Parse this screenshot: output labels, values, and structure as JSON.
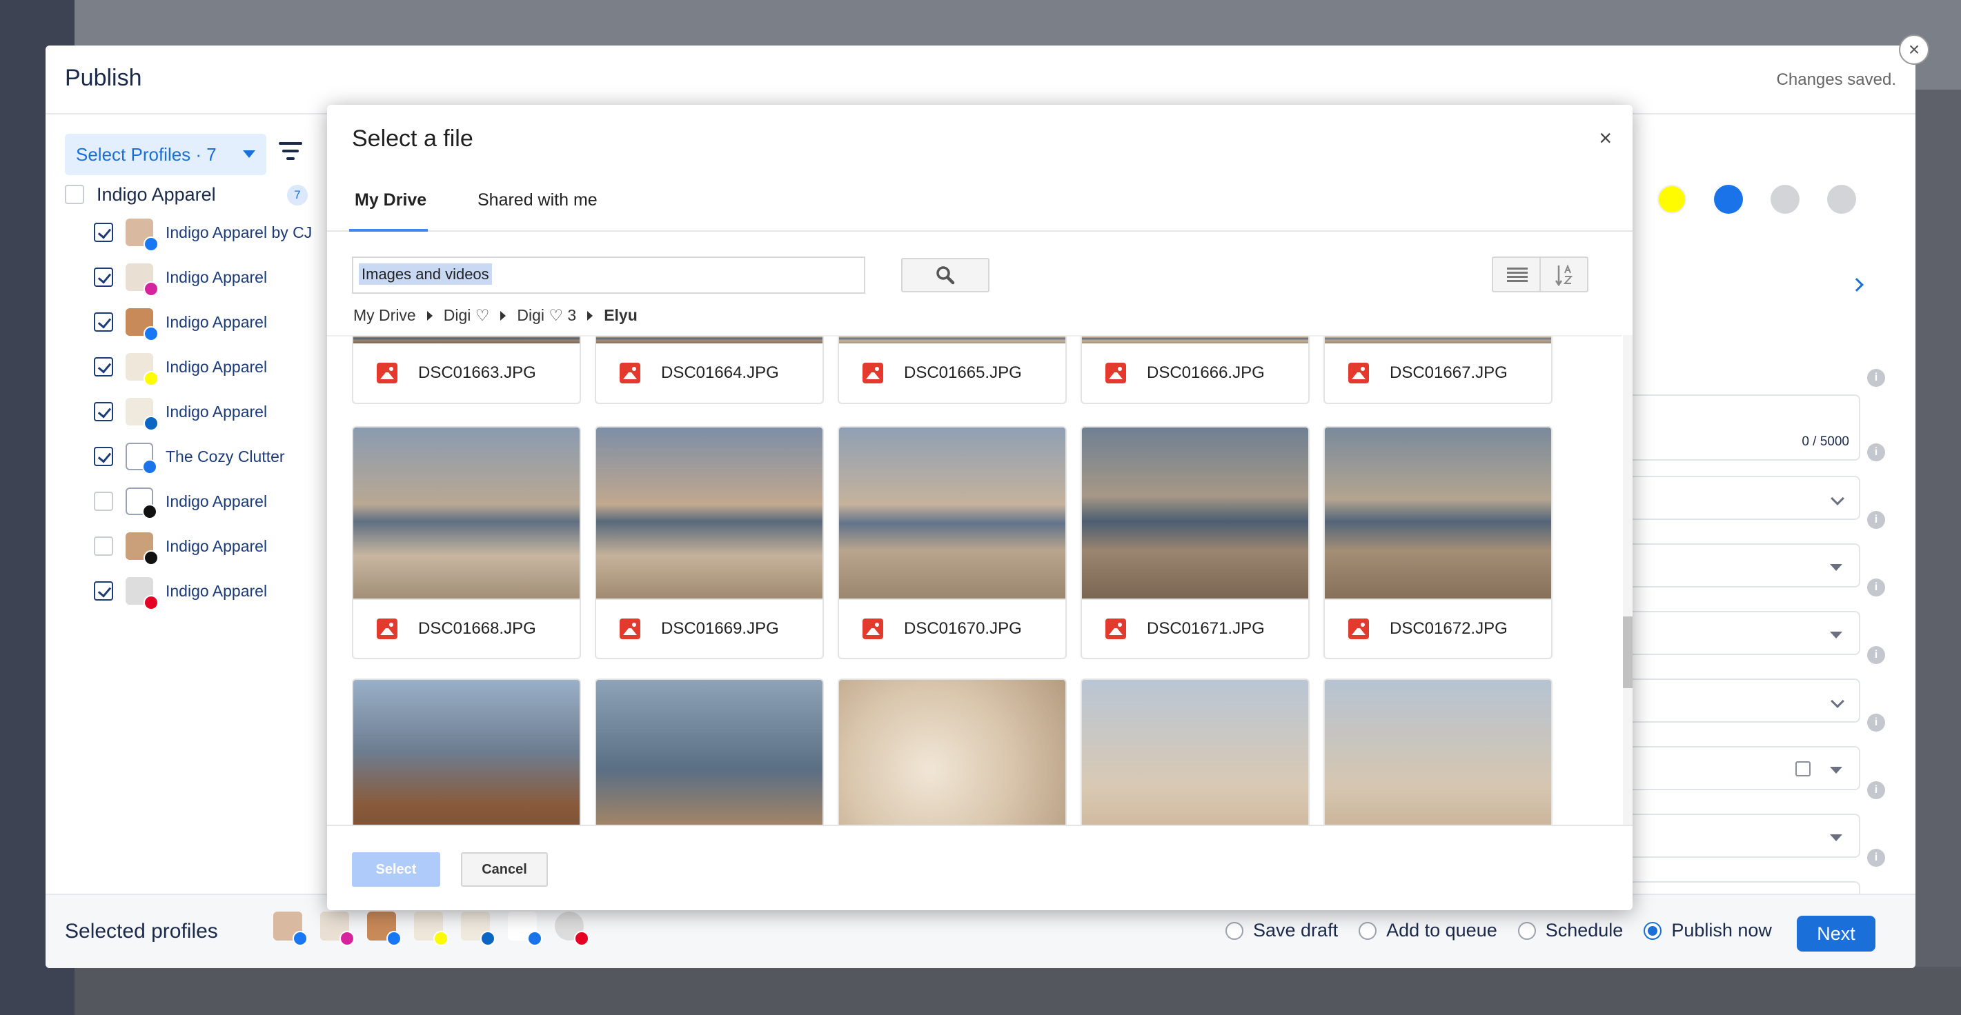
{
  "publish": {
    "title": "Publish",
    "status": "Changes saved.",
    "profiles_select": "Select Profiles · 7",
    "group": {
      "label": "Indigo Apparel",
      "count": "7"
    },
    "profiles": [
      {
        "label": "Indigo Apparel by CJ",
        "checked": true,
        "network": "facebook",
        "badge_color": "#1877f2"
      },
      {
        "label": "Indigo Apparel",
        "checked": true,
        "network": "instagram",
        "badge_color": "#d6249f"
      },
      {
        "label": "Indigo Apparel",
        "checked": true,
        "network": "facebook",
        "badge_color": "#1877f2"
      },
      {
        "label": "Indigo Apparel",
        "checked": true,
        "network": "snapchat",
        "badge_color": "#fffc00"
      },
      {
        "label": "Indigo Apparel",
        "checked": true,
        "network": "linkedin",
        "badge_color": "#0a66c2"
      },
      {
        "label": "The Cozy Clutter",
        "checked": true,
        "network": "google-business",
        "badge_color": "#1a73e8"
      },
      {
        "label": "Indigo Apparel",
        "checked": false,
        "network": "threads",
        "badge_color": "#111111"
      },
      {
        "label": "Indigo Apparel",
        "checked": false,
        "network": "tiktok",
        "badge_color": "#111111"
      },
      {
        "label": "Indigo Apparel",
        "checked": true,
        "network": "pinterest",
        "badge_color": "#e60023"
      }
    ],
    "right_panel": {
      "char_count": "0 / 5000"
    },
    "footer": {
      "selected_label": "Selected profiles",
      "options": [
        {
          "label": "Save draft",
          "selected": false
        },
        {
          "label": "Add to queue",
          "selected": false
        },
        {
          "label": "Schedule",
          "selected": false
        },
        {
          "label": "Publish now",
          "selected": true
        }
      ],
      "next_label": "Next"
    }
  },
  "picker": {
    "title": "Select a file",
    "close_glyph": "×",
    "tabs": [
      {
        "label": "My Drive",
        "active": true
      },
      {
        "label": "Shared with me",
        "active": false
      }
    ],
    "search_value": "Images and videos",
    "breadcrumb": [
      "My Drive",
      "Digi ♡",
      "Digi ♡ 3",
      "Elyu"
    ],
    "files_row1": [
      "DSC01663.JPG",
      "DSC01664.JPG",
      "DSC01665.JPG",
      "DSC01666.JPG",
      "DSC01667.JPG"
    ],
    "files_row2": [
      "DSC01668.JPG",
      "DSC01669.JPG",
      "DSC01670.JPG",
      "DSC01671.JPG",
      "DSC01672.JPG"
    ],
    "select_label": "Select",
    "cancel_label": "Cancel"
  },
  "colors": {
    "accent": "#1a6fd8",
    "file_icon": "#e23b2e",
    "select_disabled": "#aecbfa"
  }
}
